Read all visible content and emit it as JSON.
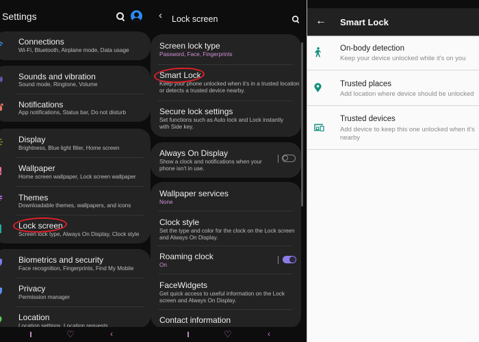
{
  "screen1": {
    "title": "Settings",
    "search_icon": "search-icon",
    "avatar_icon": "account-icon",
    "items": [
      {
        "title": "Connections",
        "subtitle": "Wi-Fi, Bluetooth, Airplane mode, Data usage",
        "icon": "wifi-icon",
        "icon_color": "#2f8de4"
      },
      {
        "title": "Sounds and vibration",
        "subtitle": "Sound mode, Ringtone, Volume",
        "icon": "volume-icon",
        "icon_color": "#7d6fe6"
      },
      {
        "title": "Notifications",
        "subtitle": "App notifications, Status bar, Do not disturb",
        "icon": "notification-icon",
        "icon_color": "#e8735f"
      },
      {
        "title": "Display",
        "subtitle": "Brightness, Blue light filter, Home screen",
        "icon": "sun-icon",
        "icon_color": "#a4d82c"
      },
      {
        "title": "Wallpaper",
        "subtitle": "Home screen wallpaper, Lock screen wallpaper",
        "icon": "image-icon",
        "icon_color": "#ea6f9c"
      },
      {
        "title": "Themes",
        "subtitle": "Downloadable themes, wallpapers, and icons",
        "icon": "brush-icon",
        "icon_color": "#a865d8"
      },
      {
        "title": "Lock screen",
        "subtitle": "Screen lock type, Always On Display, Clock style",
        "icon": "lock-screen-icon",
        "icon_color": "#1fae9e"
      },
      {
        "title": "Biometrics and security",
        "subtitle": "Face recognition, Fingerprints, Find My Mobile",
        "icon": "shield-icon",
        "icon_color": "#7b7cf0"
      },
      {
        "title": "Privacy",
        "subtitle": "Permission manager",
        "icon": "privacy-icon",
        "icon_color": "#5c8ff0"
      },
      {
        "title": "Location",
        "subtitle": "Location settings, Location requests",
        "icon": "location-icon",
        "icon_color": "#5bc85a"
      }
    ]
  },
  "screen2": {
    "title": "Lock screen",
    "back_glyph": "‹",
    "items": [
      {
        "title": "Screen lock type",
        "subtitle": "Password, Face, Fingerprints",
        "subtitle_accent": true
      },
      {
        "title": "Smart Lock",
        "subtitle_lines": [
          "Keep your phone unlocked when it's in a trusted location",
          "or detects a trusted device nearby."
        ]
      },
      {
        "title": "Secure lock settings",
        "subtitle_lines": [
          "Set functions such as Auto lock and Lock instantly",
          "with Side key."
        ]
      },
      {
        "title": "Always On Display",
        "subtitle_lines": [
          "Show a clock and notifications when your",
          "phone isn't in use."
        ],
        "toggle": false
      },
      {
        "title": "Wallpaper services",
        "subtitle": "None",
        "subtitle_accent": true
      },
      {
        "title": "Clock style",
        "subtitle_lines": [
          "Set the type and color for the clock on the Lock screen",
          "and Always On Display."
        ]
      },
      {
        "title": "Roaming clock",
        "subtitle": "On",
        "subtitle_accent": true,
        "toggle": true
      },
      {
        "title": "FaceWidgets",
        "subtitle_lines": [
          "Get quick access to useful information on the Lock",
          "screen and Always On Display."
        ]
      },
      {
        "title": "Contact information",
        "subtitle": ""
      }
    ]
  },
  "screen3": {
    "title": "Smart Lock",
    "back_glyph": "←",
    "items": [
      {
        "title": "On-body detection",
        "subtitle_lines": [
          "Keep your device unlocked while it's on you"
        ],
        "icon": "walking-person-icon"
      },
      {
        "title": "Trusted places",
        "subtitle_lines": [
          "Add location where device should be unlocked"
        ],
        "icon": "place-pin-icon"
      },
      {
        "title": "Trusted devices",
        "subtitle_lines": [
          "Add device to keep this one unlocked when it's",
          "nearby"
        ],
        "icon": "devices-icon"
      }
    ],
    "accent_color": "#13907f"
  },
  "navbar": {
    "recent_icon": "recent-apps-icon",
    "home_glyph": "♡",
    "back_glyph": "‹"
  },
  "highlight_color": "#e0202a"
}
